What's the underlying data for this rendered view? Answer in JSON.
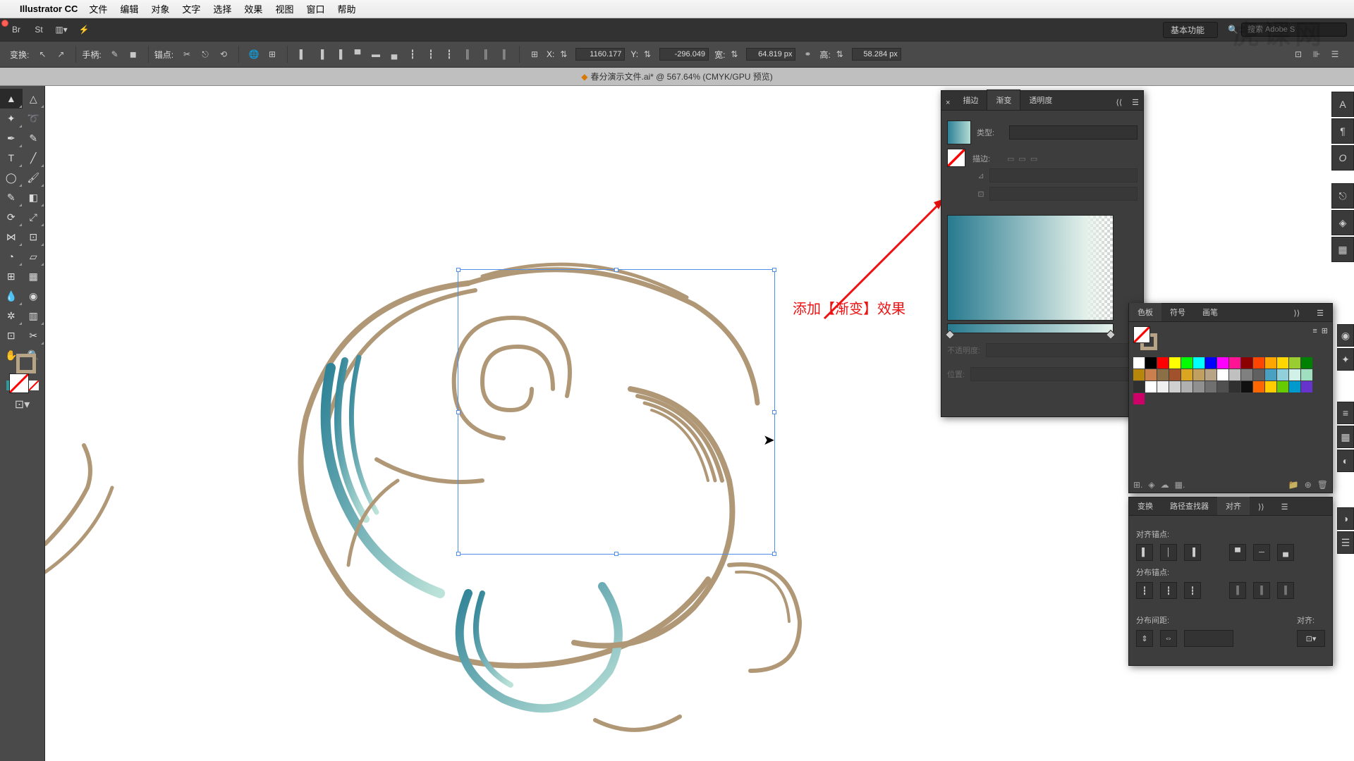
{
  "menu": {
    "app": "Illustrator CC",
    "items": [
      "文件",
      "编辑",
      "对象",
      "文字",
      "选择",
      "效果",
      "视图",
      "窗口",
      "帮助"
    ]
  },
  "topbar": {
    "dropdown": "基本功能",
    "search_ph": "搜索 Adobe S"
  },
  "ctrl": {
    "transform": "变换:",
    "handle": "手柄:",
    "anchor": "锚点:",
    "x": "X:",
    "xv": "1160.177",
    "y": "Y:",
    "yv": "-296.049",
    "w": "宽:",
    "wv": "64.819 px",
    "h": "高:",
    "hv": "58.284 px"
  },
  "doc": {
    "title": "春分演示文件.ai* @ 567.64% (CMYK/GPU 预览)"
  },
  "grad": {
    "tab_stroke": "描边",
    "tab_grad": "渐变",
    "tab_op": "透明度",
    "type": "类型:",
    "strk": "描边:",
    "opacity": "不透明度:",
    "position": "位置:"
  },
  "swatches": {
    "tab_color": "色板",
    "tab_sym": "符号",
    "tab_brush": "画笔"
  },
  "align": {
    "tab_trans": "变换",
    "tab_pf": "路径查找器",
    "tab_align": "对齐",
    "sec1": "对齐锚点:",
    "sec2": "分布锚点:",
    "sec3": "分布间距:",
    "just": "对齐:"
  },
  "annotation": "添加【渐变】效果",
  "watermark": "虎课网",
  "swatch_colors": [
    "#ffffff",
    "#000000",
    "#ff0000",
    "#ffff00",
    "#00ff00",
    "#00ffff",
    "#0000ff",
    "#ff00ff",
    "#ff1493",
    "#8b0000",
    "#ff4500",
    "#ffa500",
    "#ffd700",
    "#9acd32",
    "#008000",
    "#b8860b",
    "#c97f4e",
    "#8b6f47",
    "#a0522d",
    "#daa520",
    "#c0a060",
    "#b7a487",
    "#ffffff",
    "#c0c0c0",
    "#808080",
    "#606060",
    "#4aa0c0",
    "#8fd0da",
    "#d0f0e8",
    "#a0e0c0",
    "#303030",
    "#fff",
    "#f0f0f0",
    "#d0d0d0",
    "#b0b0b0",
    "#909090",
    "#707070",
    "#505050",
    "#303030",
    "#101010",
    "#ff6600",
    "#ffcc00",
    "#66cc00",
    "#0099cc",
    "#6633cc",
    "#cc0066"
  ],
  "chart_data": null
}
